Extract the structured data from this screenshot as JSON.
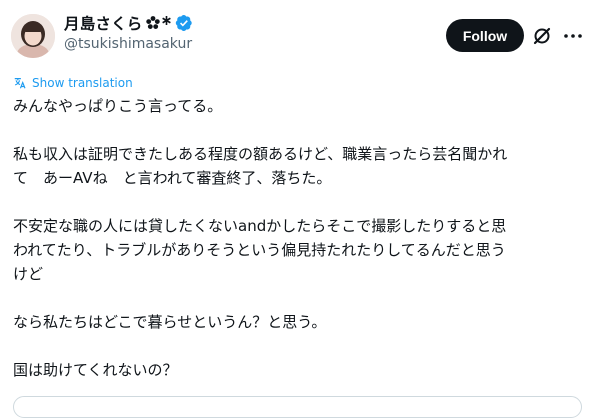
{
  "author": {
    "display_name": "月島さくら",
    "handle": "@tsukishimasakur",
    "verified": true
  },
  "header": {
    "follow_label": "Follow",
    "grok_icon": "grok-slash-circle-icon",
    "more_icon": "more-horizontal-icon"
  },
  "translate": {
    "label": "Show translation",
    "icon": "translate-icon"
  },
  "tweet": {
    "p1": "みんなやっぱりこう言ってる。",
    "p2a": "私も収入は証明できたしある程度の額あるけど、職業言ったら芸名聞かれ",
    "p2b": "て　あーAVね　と言われて審査終了、落ちた。",
    "p3a": "不安定な職の人には貸したくないandかしたらそこで撮影したりすると思",
    "p3b": "われてたり、トラブルがありそうという偏見持たれたりしてるんだと思う",
    "p3c": "けど",
    "p4": "なら私たちはどこで暮らせというん？と思う。",
    "p5": "国は助けてくれないの？"
  },
  "colors": {
    "text": "#0f1419",
    "secondary": "#536471",
    "link": "#1d9bf0",
    "verified": "#1d9bf0",
    "follow_bg": "#0f1419"
  }
}
